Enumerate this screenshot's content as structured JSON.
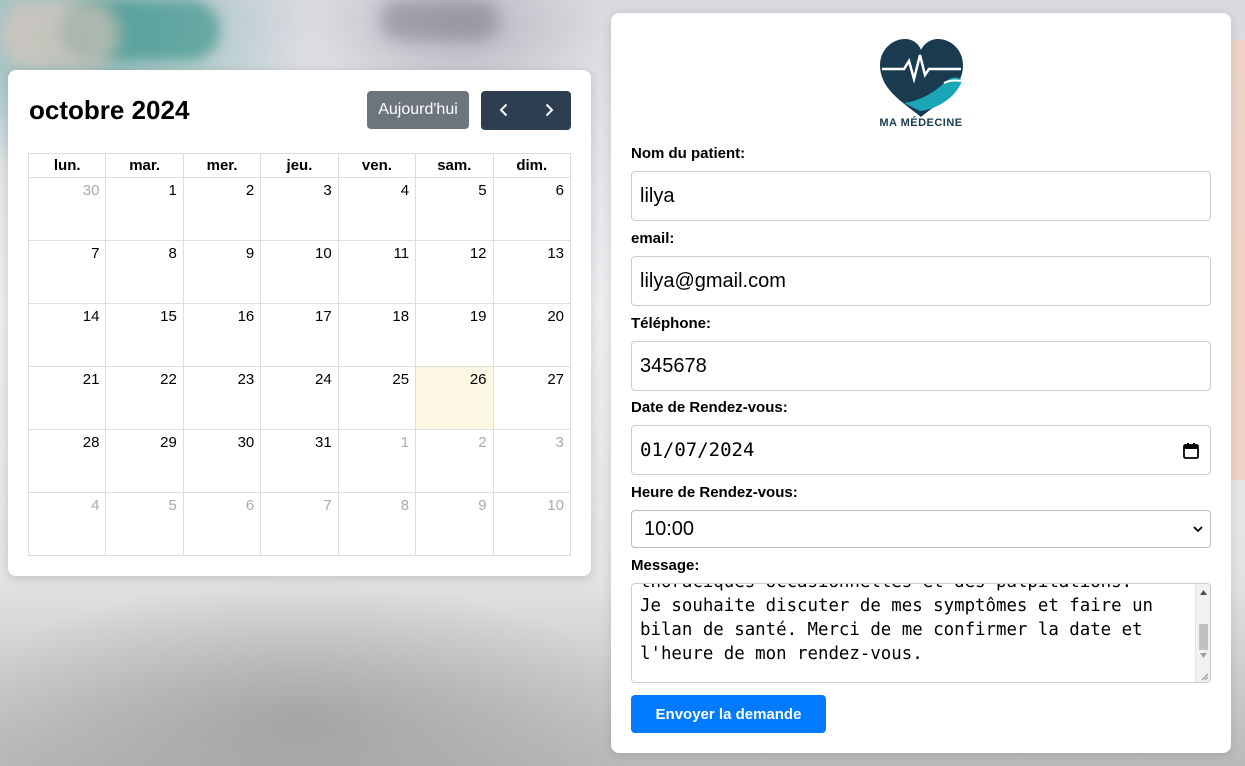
{
  "calendar": {
    "title": "octobre 2024",
    "today_label": "Aujourd'hui",
    "weekdays": [
      "lun.",
      "mar.",
      "mer.",
      "jeu.",
      "ven.",
      "sam.",
      "dim."
    ],
    "weeks": [
      [
        {
          "d": "30",
          "other": true
        },
        {
          "d": "1"
        },
        {
          "d": "2"
        },
        {
          "d": "3"
        },
        {
          "d": "4"
        },
        {
          "d": "5"
        },
        {
          "d": "6"
        }
      ],
      [
        {
          "d": "7"
        },
        {
          "d": "8"
        },
        {
          "d": "9"
        },
        {
          "d": "10"
        },
        {
          "d": "11"
        },
        {
          "d": "12"
        },
        {
          "d": "13"
        }
      ],
      [
        {
          "d": "14"
        },
        {
          "d": "15"
        },
        {
          "d": "16"
        },
        {
          "d": "17"
        },
        {
          "d": "18"
        },
        {
          "d": "19"
        },
        {
          "d": "20"
        }
      ],
      [
        {
          "d": "21"
        },
        {
          "d": "22"
        },
        {
          "d": "23"
        },
        {
          "d": "24"
        },
        {
          "d": "25"
        },
        {
          "d": "26",
          "today": true
        },
        {
          "d": "27"
        }
      ],
      [
        {
          "d": "28"
        },
        {
          "d": "29"
        },
        {
          "d": "30"
        },
        {
          "d": "31"
        },
        {
          "d": "1",
          "other": true
        },
        {
          "d": "2",
          "other": true
        },
        {
          "d": "3",
          "other": true
        }
      ],
      [
        {
          "d": "4",
          "other": true
        },
        {
          "d": "5",
          "other": true
        },
        {
          "d": "6",
          "other": true
        },
        {
          "d": "7",
          "other": true
        },
        {
          "d": "8",
          "other": true
        },
        {
          "d": "9",
          "other": true
        },
        {
          "d": "10",
          "other": true
        }
      ]
    ],
    "colors": {
      "today_bg": "#fcf8e3",
      "nav_bg": "#2c3e50",
      "today_btn": "#6c757d"
    }
  },
  "form": {
    "logo_text": "MA MÉDECINE",
    "name_label": "Nom du patient:",
    "name_value": "lilya",
    "email_label": "email:",
    "email_value": "lilya@gmail.com",
    "phone_label": "Téléphone:",
    "phone_value": "345678",
    "date_label": "Date de Rendez-vous:",
    "date_value": "01/07/2024",
    "time_label": "Heure de Rendez-vous:",
    "time_value": "10:00",
    "message_label": "Message:",
    "message_value": "thoraciques occasionnelles et des palpitations.\nJe souhaite discuter de mes symptômes et faire un\nbilan de santé. Merci de me confirmer la date et\nl'heure de mon rendez-vous.",
    "submit_label": "Envoyer la demande",
    "colors": {
      "submit": "#007bff",
      "logo": "#1a3a4f",
      "logo_accent": "#1aa6b7"
    }
  }
}
